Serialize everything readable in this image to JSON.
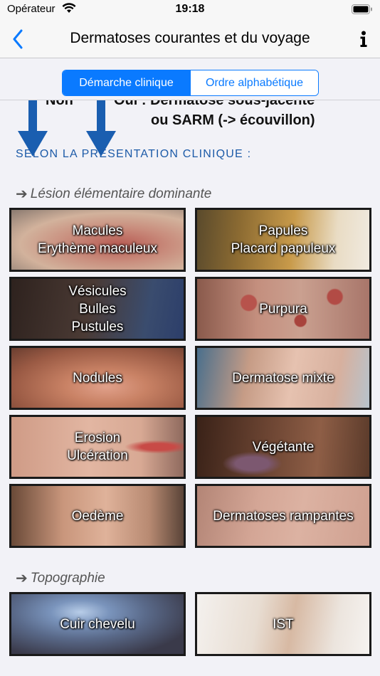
{
  "status_bar": {
    "carrier": "Opérateur",
    "time": "19:18"
  },
  "nav": {
    "title": "Dermatoses courantes et du voyage",
    "back_icon": "chevron-left-icon",
    "info_icon": "info-icon"
  },
  "segments": {
    "active": "Démarche clinique",
    "inactive": "Ordre alphabétique"
  },
  "flow": {
    "left_text": "Non",
    "right_line1": "Oui : Dermatose sous-jacente",
    "right_line2": "ou SARM (-> écouvillon)"
  },
  "section_title": "SELON LA PRÉSENTATION CLINIQUE :",
  "lesion_heading": "Lésion élémentaire dominante",
  "lesions": [
    {
      "line1": "Macules",
      "line2": "Erythème maculeux"
    },
    {
      "line1": "Papules",
      "line2": "Placard papuleux"
    },
    {
      "line1": "Vésicules",
      "line2": "Bulles",
      "line3": "Pustules"
    },
    {
      "line1": "Purpura"
    },
    {
      "line1": "Nodules"
    },
    {
      "line1": "Dermatose mixte"
    },
    {
      "line1": "Erosion",
      "line2": "Ulcération"
    },
    {
      "line1": "Végétante"
    },
    {
      "line1": "Oedème"
    },
    {
      "line1": "Dermatoses rampantes"
    }
  ],
  "topo_heading": "Topographie",
  "topo": [
    {
      "line1": "Cuir chevelu"
    },
    {
      "line1": "IST"
    }
  ],
  "colors": {
    "accent": "#0a7aff",
    "section_title": "#1d5ba8",
    "flow_arrow": "#1a5eb0"
  }
}
